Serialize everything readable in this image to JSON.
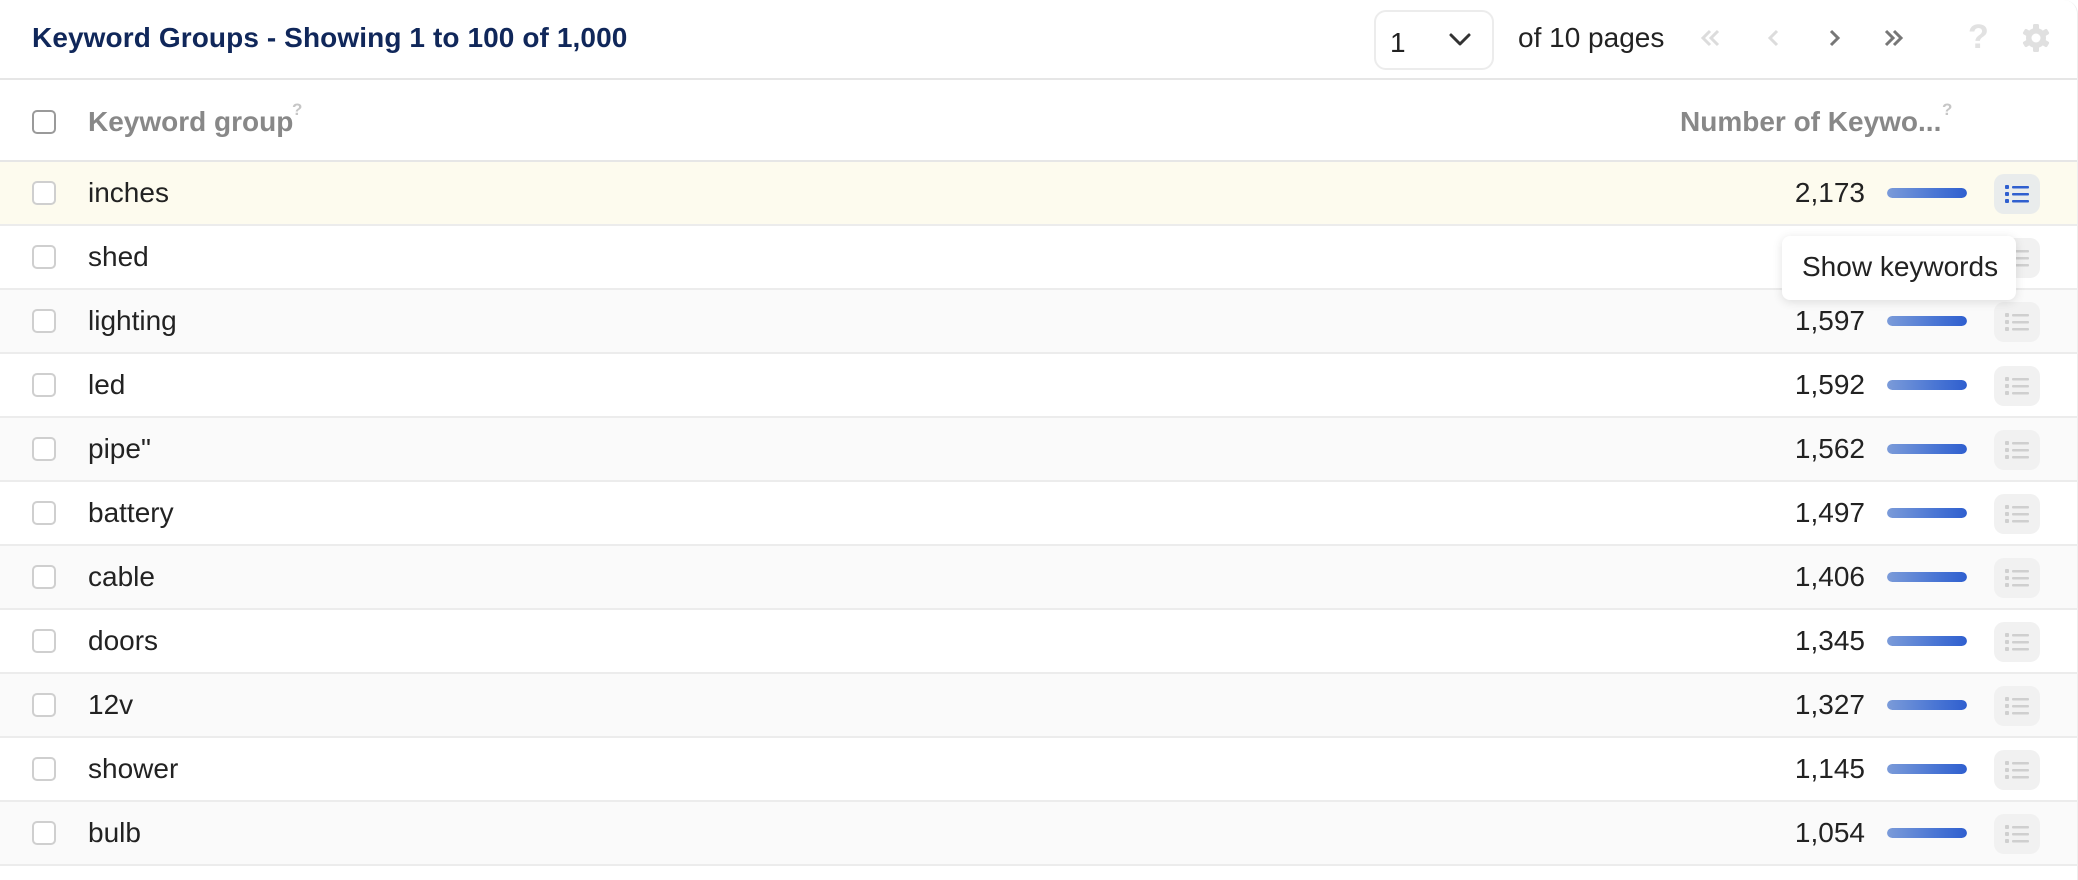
{
  "header": {
    "title": "Keyword Groups - Showing 1 to 100 of 1,000",
    "page_select": {
      "value": "1",
      "icon": "chevron-down-icon"
    },
    "of_pages": "of 10 pages",
    "pagination": [
      {
        "name": "first-page",
        "icon": "double-chevron-left-icon",
        "enabled": false
      },
      {
        "name": "previous-page",
        "icon": "chevron-left-icon",
        "enabled": false
      },
      {
        "name": "next-page",
        "icon": "chevron-right-icon",
        "enabled": true
      },
      {
        "name": "last-page",
        "icon": "double-chevron-right-icon",
        "enabled": true
      }
    ],
    "help": "?",
    "settings_icon": "gear-icon"
  },
  "table": {
    "columns": [
      {
        "label": "Keyword group",
        "help": "?"
      },
      {
        "label": "Number of Keywo...",
        "help": "?"
      }
    ],
    "max_value": 2173,
    "rows": [
      {
        "name": "inches",
        "count": "2,173",
        "value": 2173,
        "highlighted": true
      },
      {
        "name": "shed",
        "count": "",
        "value": null,
        "highlighted": false
      },
      {
        "name": "lighting",
        "count": "1,597",
        "value": 1597,
        "highlighted": false
      },
      {
        "name": "led",
        "count": "1,592",
        "value": 1592,
        "highlighted": false
      },
      {
        "name": "pipe\"",
        "count": "1,562",
        "value": 1562,
        "highlighted": false
      },
      {
        "name": "battery",
        "count": "1,497",
        "value": 1497,
        "highlighted": false
      },
      {
        "name": "cable",
        "count": "1,406",
        "value": 1406,
        "highlighted": false
      },
      {
        "name": "doors",
        "count": "1,345",
        "value": 1345,
        "highlighted": false
      },
      {
        "name": "12v",
        "count": "1,327",
        "value": 1327,
        "highlighted": false
      },
      {
        "name": "shower",
        "count": "1,145",
        "value": 1145,
        "highlighted": false
      },
      {
        "name": "bulb",
        "count": "1,054",
        "value": 1054,
        "highlighted": false
      }
    ],
    "row_action_icon": "list-icon"
  },
  "tooltip": {
    "text": "Show keywords"
  },
  "colors": {
    "title": "#10275a",
    "highlight_row": "#fdfbee",
    "bar": "#4a76d4",
    "list_icon_active": "#2f5fcf",
    "list_icon_inactive": "#cfcfcf"
  }
}
